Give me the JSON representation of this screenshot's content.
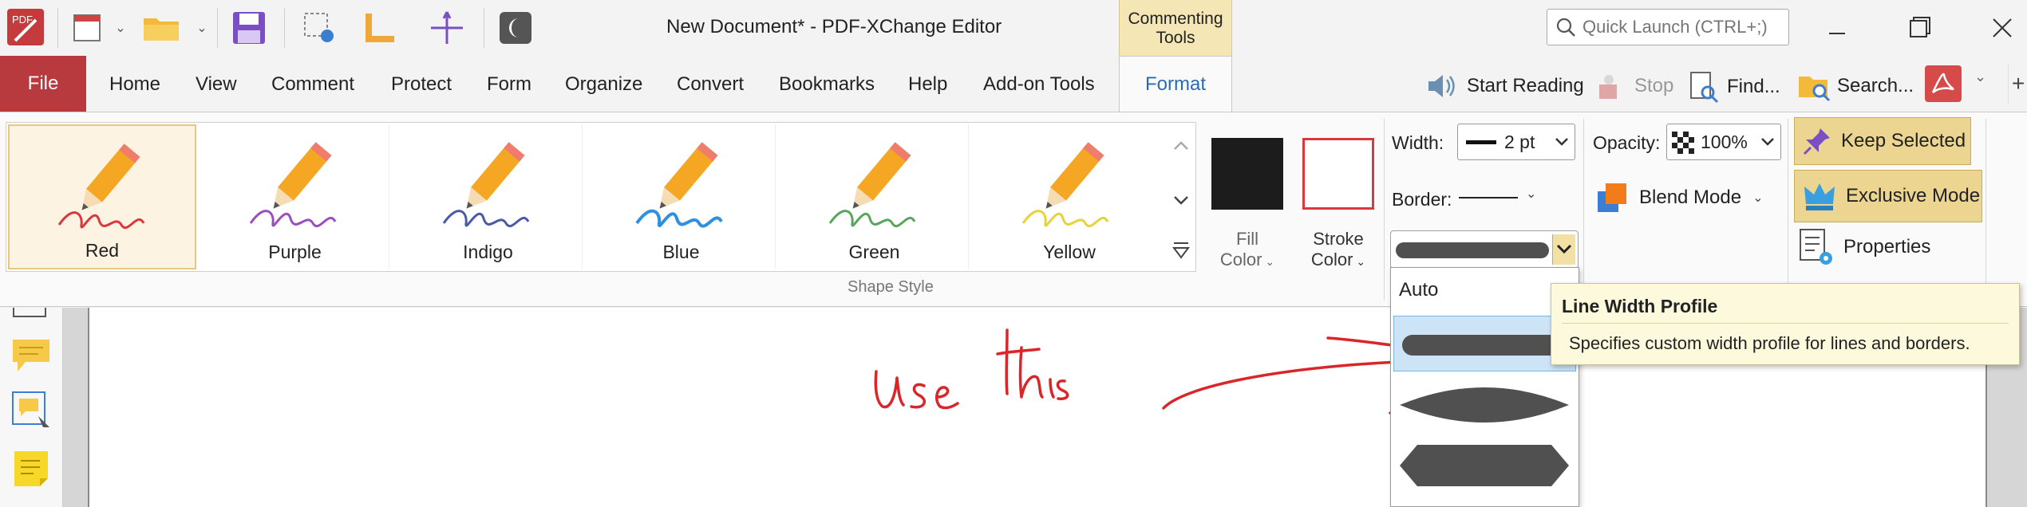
{
  "window": {
    "title": "New Document* - PDF-XChange Editor",
    "context_tab": "Commenting Tools",
    "quick_launch_placeholder": "Quick Launch (CTRL+;)"
  },
  "menu": {
    "file": "File",
    "items": [
      "Home",
      "View",
      "Comment",
      "Protect",
      "Form",
      "Organize",
      "Convert",
      "Bookmarks",
      "Help",
      "Add-on Tools"
    ],
    "active_tab": "Format",
    "right_tools": {
      "start_reading": "Start Reading",
      "stop": "Stop",
      "find": "Find...",
      "search": "Search..."
    }
  },
  "ribbon": {
    "shape_styles": [
      {
        "name": "Red",
        "color": "#d9383d"
      },
      {
        "name": "Purple",
        "color": "#9b4fbf"
      },
      {
        "name": "Indigo",
        "color": "#4a5aa8"
      },
      {
        "name": "Blue",
        "color": "#2f8fe0"
      },
      {
        "name": "Green",
        "color": "#58a65c"
      },
      {
        "name": "Yellow",
        "color": "#e8d23a"
      }
    ],
    "selected_style": "Red",
    "group_label": "Shape Style",
    "fill_color": {
      "label1": "Fill",
      "label2": "Color",
      "swatch": "#1c1c1c"
    },
    "stroke_color": {
      "label1": "Stroke",
      "label2": "Color",
      "swatch": "#d9383d"
    },
    "width": {
      "label": "Width:",
      "value": "2 pt"
    },
    "border": {
      "label": "Border:"
    },
    "opacity": {
      "label": "Opacity:",
      "value": "100%"
    },
    "blend_mode": "Blend Mode",
    "keep_selected": "Keep Selected",
    "exclusive_mode": "Exclusive Mode",
    "properties": "Properties"
  },
  "dropdown": {
    "auto": "Auto",
    "options": [
      "uniform",
      "tapered",
      "hexagon"
    ],
    "selected_index": 0
  },
  "tooltip": {
    "title": "Line Width Profile",
    "body": "Specifies custom width profile for lines and borders."
  },
  "annotation": {
    "text": "Use this",
    "color": "#d9262a"
  }
}
